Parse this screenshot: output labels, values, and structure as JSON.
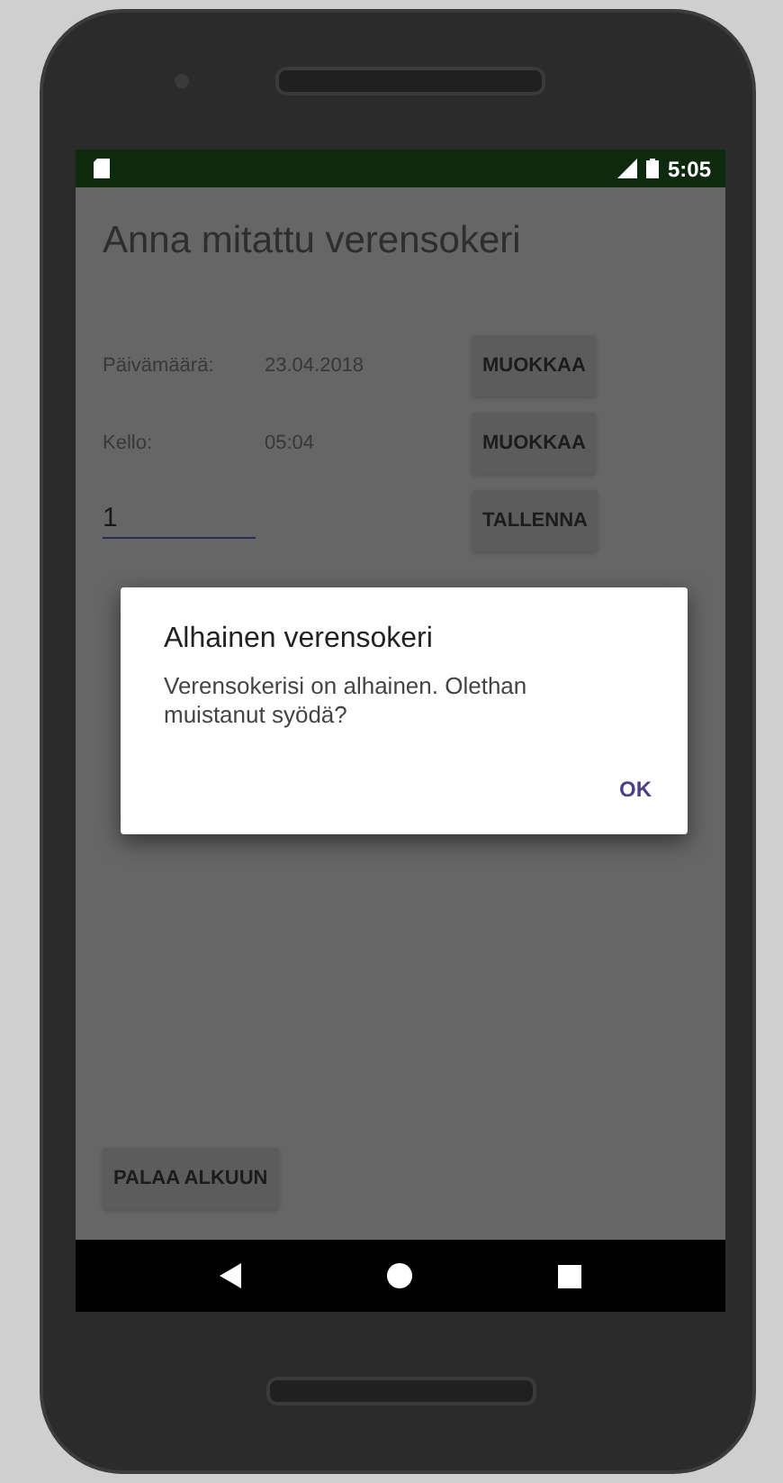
{
  "status_bar": {
    "time": "5:05"
  },
  "title": "Anna mitattu verensokeri",
  "rows": [
    {
      "label": "Päivämäärä:",
      "value": "23.04.2018",
      "button": "MUOKKAA"
    },
    {
      "label": "Kello:",
      "value": "05:04",
      "button": "MUOKKAA"
    }
  ],
  "input": {
    "value": "1",
    "button": "TALLENNA"
  },
  "back_button": "PALAA ALKUUN",
  "dialog": {
    "title": "Alhainen verensokeri",
    "message": "Verensokerisi on alhainen. Olethan muistanut syödä?",
    "button": "OK"
  }
}
